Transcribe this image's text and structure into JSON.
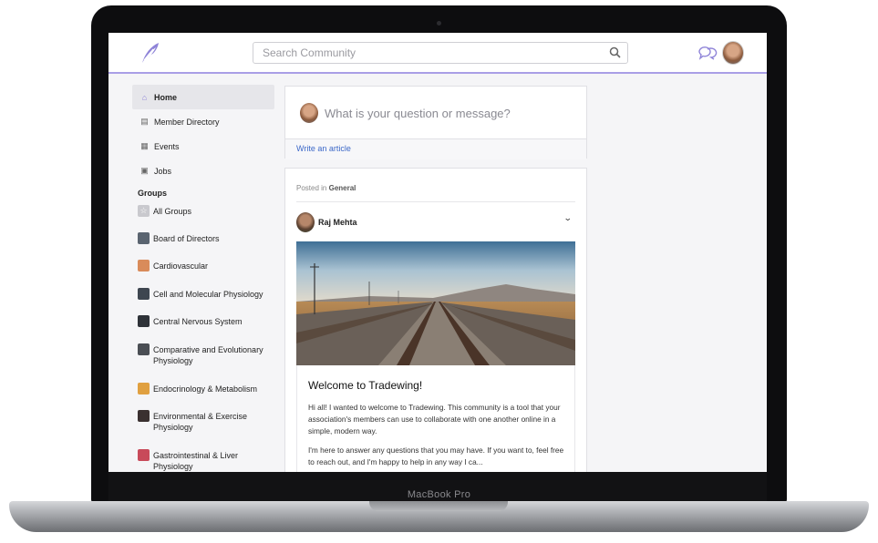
{
  "device": {
    "brand_label": "MacBook Pro"
  },
  "header": {
    "search_placeholder": "Search Community",
    "icons": {
      "logo": "feather-logo-icon",
      "search": "search-icon",
      "chat": "chat-bubbles-icon"
    }
  },
  "sidebar": {
    "nav": [
      {
        "label": "Home",
        "icon": "home-icon",
        "active": true
      },
      {
        "label": "Member Directory",
        "icon": "directory-icon"
      },
      {
        "label": "Events",
        "icon": "calendar-icon"
      },
      {
        "label": "Jobs",
        "icon": "briefcase-icon"
      }
    ],
    "groups_heading": "Groups",
    "groups": [
      {
        "label": "All Groups",
        "color": "#c9c9ce"
      },
      {
        "label": "Board of Directors",
        "color": "#5a6470"
      },
      {
        "label": "Cardiovascular",
        "color": "#d98b5a"
      },
      {
        "label": "Cell and Molecular Physiology",
        "color": "#3e4650"
      },
      {
        "label": "Central Nervous System",
        "color": "#2e3238"
      },
      {
        "label": "Comparative and Evolutionary Physiology",
        "color": "#4a4e54"
      },
      {
        "label": "Endocrinology & Metabolism",
        "color": "#e0a040"
      },
      {
        "label": "Environmental & Exercise Physiology",
        "color": "#3a3030"
      },
      {
        "label": "Gastrointestinal & Liver Physiology",
        "color": "#c84a5a"
      }
    ]
  },
  "composer": {
    "prompt": "What is your question or message?",
    "write_article": "Write an article"
  },
  "post": {
    "posted_in_prefix": "Posted in",
    "posted_in_group": "General",
    "author": "Raj Mehta",
    "title": "Welcome to Tradewing!",
    "paragraph1": "Hi all! I wanted to welcome to Tradewing. This community is a tool that your association's members can use to collaborate with one another online in a simple, modern way.",
    "paragraph2": "I'm here to answer any questions that you may have. If you want to, feel free to reach out, and I'm happy to help in any way I ca..."
  }
}
